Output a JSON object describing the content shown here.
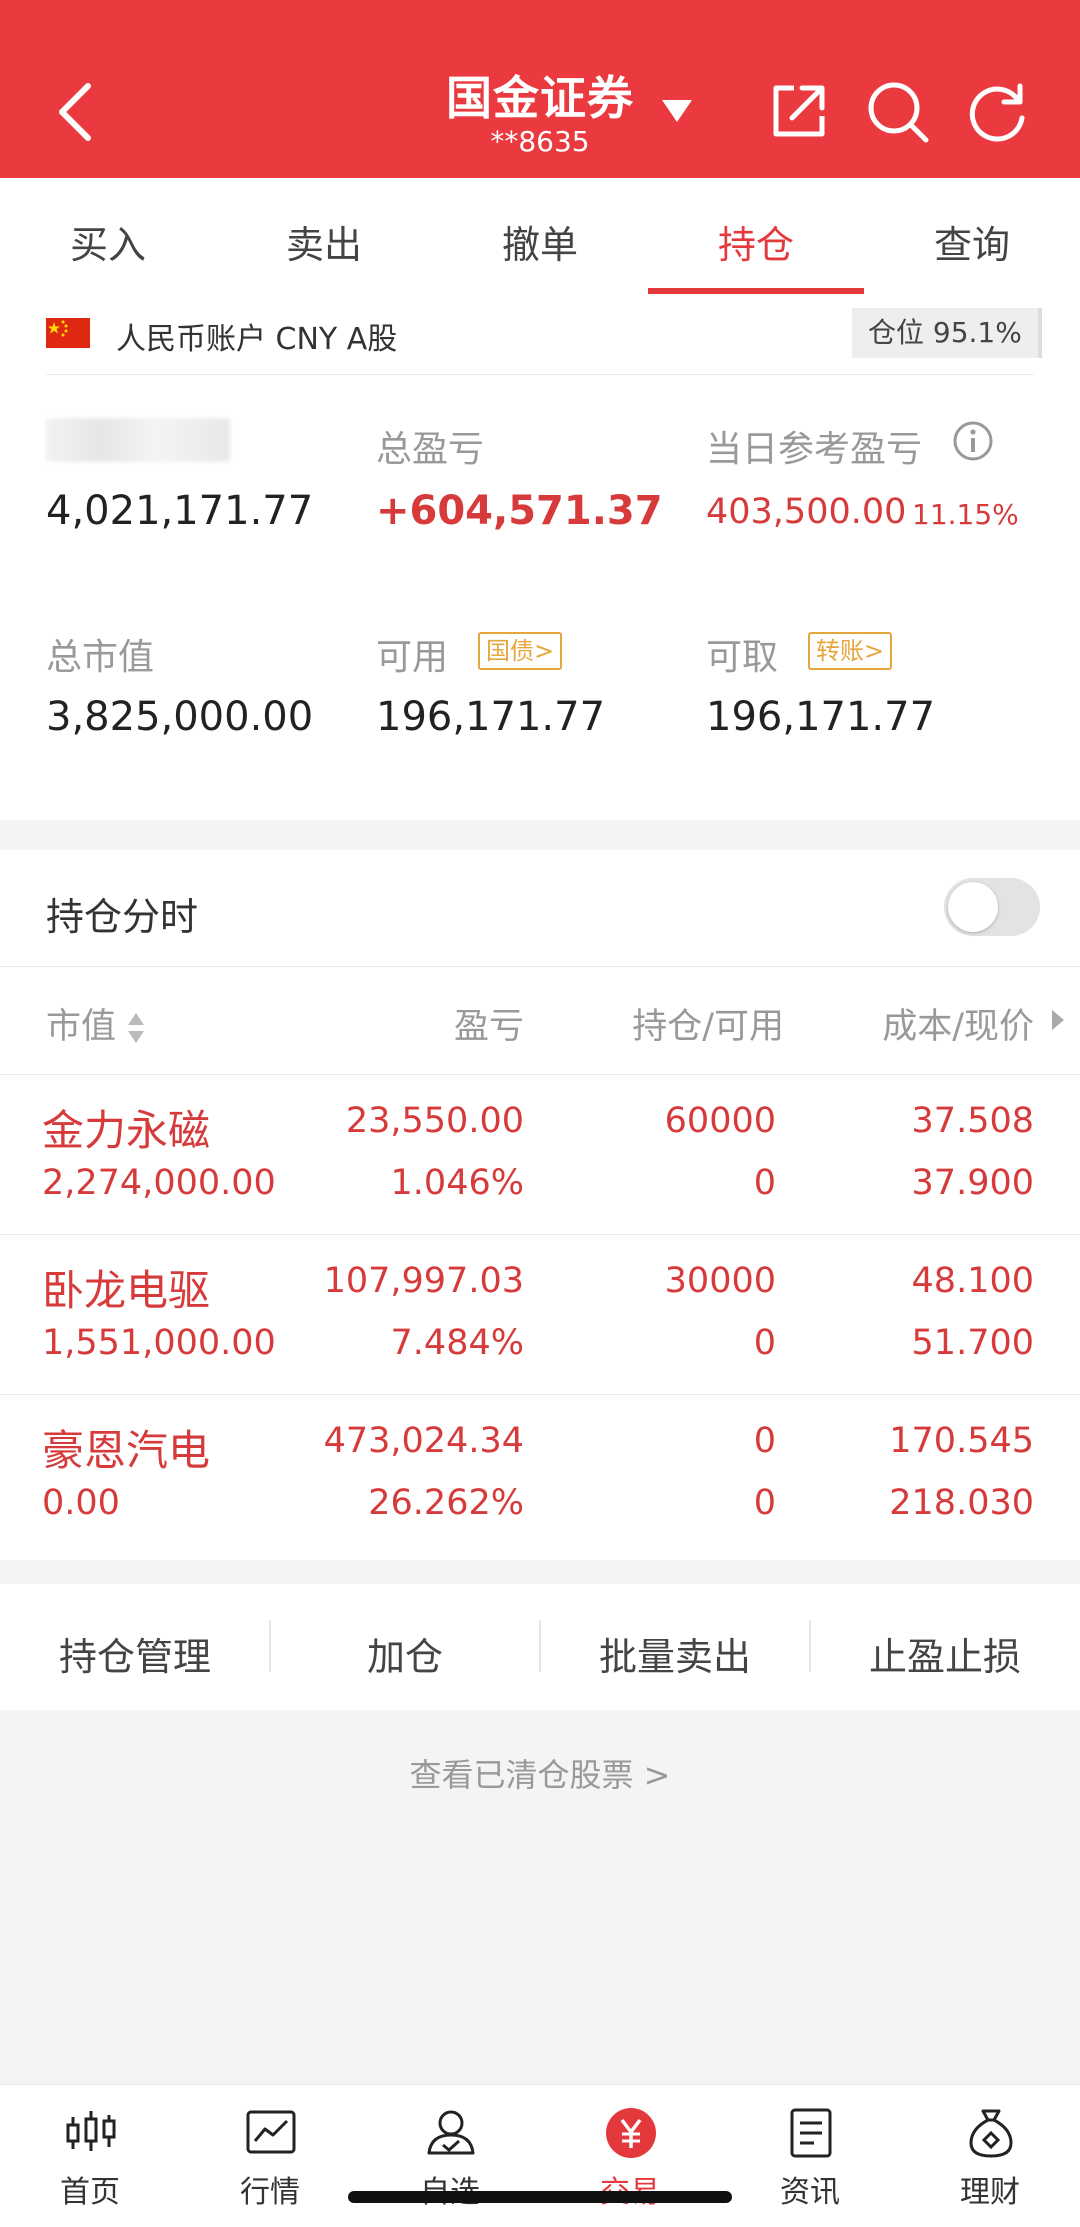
{
  "header": {
    "title": "国金证券",
    "account_masked": "**8635"
  },
  "tabs": [
    "买入",
    "卖出",
    "撤单",
    "持仓",
    "查询"
  ],
  "active_tab": "持仓",
  "account": {
    "currency_label": "人民币账户 CNY A股",
    "position_ratio": "仓位 95.1%",
    "total_assets": "4,021,171.77",
    "total_pl_label": "总盈亏",
    "total_pl": "+604,571.37",
    "today_pl_label": "当日参考盈亏",
    "today_pl": "403,500.00",
    "today_pl_pct": "11.15%",
    "market_value_label": "总市值",
    "market_value": "3,825,000.00",
    "available_label": "可用",
    "available_tag": "国债>",
    "available": "196,171.77",
    "withdrawable_label": "可取",
    "withdrawable_tag": "转账>",
    "withdrawable": "196,171.77"
  },
  "holdings": {
    "section_title": "持仓分时",
    "toggle_on": false,
    "columns": [
      "市值",
      "盈亏",
      "持仓/可用",
      "成本/现价"
    ],
    "rows": [
      {
        "name": "金力永磁",
        "market_value": "2,274,000.00",
        "pl": "23,550.00",
        "pl_pct": "1.046%",
        "position": "60000",
        "available": "0",
        "cost": "37.508",
        "price": "37.900"
      },
      {
        "name": "卧龙电驱",
        "market_value": "1,551,000.00",
        "pl": "107,997.03",
        "pl_pct": "7.484%",
        "position": "30000",
        "available": "0",
        "cost": "48.100",
        "price": "51.700"
      },
      {
        "name": "豪恩汽电",
        "market_value": "0.00",
        "pl": "473,024.34",
        "pl_pct": "26.262%",
        "position": "0",
        "available": "0",
        "cost": "170.545",
        "price": "218.030"
      }
    ]
  },
  "actions": [
    "持仓管理",
    "加仓",
    "批量卖出",
    "止盈止损"
  ],
  "cleared_link": "查看已清仓股票 >",
  "nav": [
    {
      "label": "首页",
      "icon": "candlestick-icon"
    },
    {
      "label": "行情",
      "icon": "chart-icon"
    },
    {
      "label": "自选",
      "icon": "person-icon"
    },
    {
      "label": "交易",
      "icon": "yuan-icon"
    },
    {
      "label": "资讯",
      "icon": "document-icon"
    },
    {
      "label": "理财",
      "icon": "moneybag-icon"
    }
  ],
  "nav_active": "交易",
  "colors": {
    "brand_red": "#ea3a40",
    "text_red": "#d63a3a",
    "tag_orange": "#e6a63c"
  }
}
